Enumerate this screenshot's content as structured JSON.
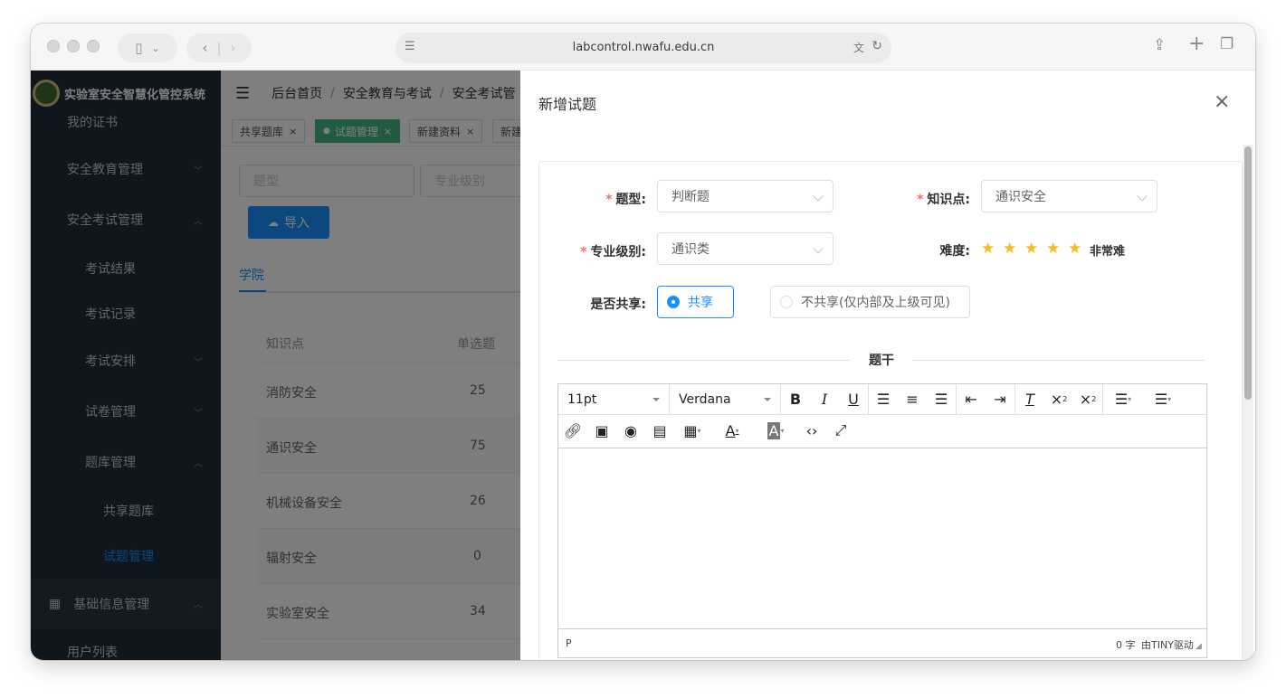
{
  "browser": {
    "url": "labcontrol.nwafu.edu.cn"
  },
  "sidebar": {
    "app_title": "实验室安全智慧化管控系统",
    "items": [
      {
        "label": "我的证书"
      },
      {
        "label": "安全教育管理"
      },
      {
        "label": "安全考试管理"
      },
      {
        "label": "考试结果"
      },
      {
        "label": "考试记录"
      },
      {
        "label": "考试安排"
      },
      {
        "label": "试卷管理"
      },
      {
        "label": "题库管理"
      },
      {
        "label": "共享题库"
      },
      {
        "label": "试题管理"
      },
      {
        "label": "基础信息管理"
      },
      {
        "label": "用户列表"
      }
    ]
  },
  "navbar": {
    "breadcrumb": [
      "后台首页",
      "安全教育与考试",
      "安全考试管"
    ],
    "separator": "/"
  },
  "tags_view": {
    "tags": [
      {
        "label": "共享题库"
      },
      {
        "label": "试题管理"
      },
      {
        "label": "新建资料"
      },
      {
        "label": "新建"
      }
    ],
    "close_glyph": "×"
  },
  "filters": {
    "type_placeholder": "题型",
    "level_placeholder": "专业级别",
    "import_label": "导入"
  },
  "tabs": {
    "active": "学院"
  },
  "table": {
    "columns": [
      "知识点",
      "单选题"
    ],
    "rows": [
      {
        "topic": "消防安全",
        "count": "25"
      },
      {
        "topic": "通识安全",
        "count": "75"
      },
      {
        "topic": "机械设备安全",
        "count": "26"
      },
      {
        "topic": "辐射安全",
        "count": "0"
      },
      {
        "topic": "实验室安全",
        "count": "34"
      }
    ]
  },
  "drawer": {
    "title": "新增试题",
    "close_glyph": "×",
    "form": {
      "type_label": "题型:",
      "type_value": "判断题",
      "knowledge_label": "知识点:",
      "knowledge_value": "通识安全",
      "level_label": "专业级别:",
      "level_value": "通识类",
      "difficulty_label": "难度:",
      "difficulty_stars": 5,
      "difficulty_text": "非常难",
      "share_label": "是否共享:",
      "share_options": [
        "共享",
        "不共享(仅内部及上级可见)"
      ],
      "share_selected": "共享",
      "required_mark": "*",
      "stem_label": "题干"
    },
    "editor": {
      "font_size": "11pt",
      "font_family": "Verdana",
      "path": "P",
      "word_count": "0 字",
      "powered_by": "由TINY驱动",
      "toolbar_row1_icons": [
        "bold-icon",
        "italic-icon",
        "underline-icon",
        "align-left-icon",
        "align-center-icon",
        "align-right-icon",
        "outdent-icon",
        "indent-icon",
        "clear-format-icon",
        "subscript-icon",
        "superscript-icon",
        "bullet-list-icon",
        "numbered-list-icon"
      ],
      "toolbar_row2_icons": [
        "link-icon",
        "image-icon",
        "preview-icon",
        "media-icon",
        "table-icon",
        "text-color-icon",
        "background-color-icon",
        "code-icon",
        "fullscreen-icon"
      ]
    }
  },
  "colors": {
    "sidebar_bg": "#1f2d3d",
    "accent": "#1890ff",
    "active_tag": "#42b983",
    "star": "#f7ba2a",
    "required": "#f56c6c"
  }
}
